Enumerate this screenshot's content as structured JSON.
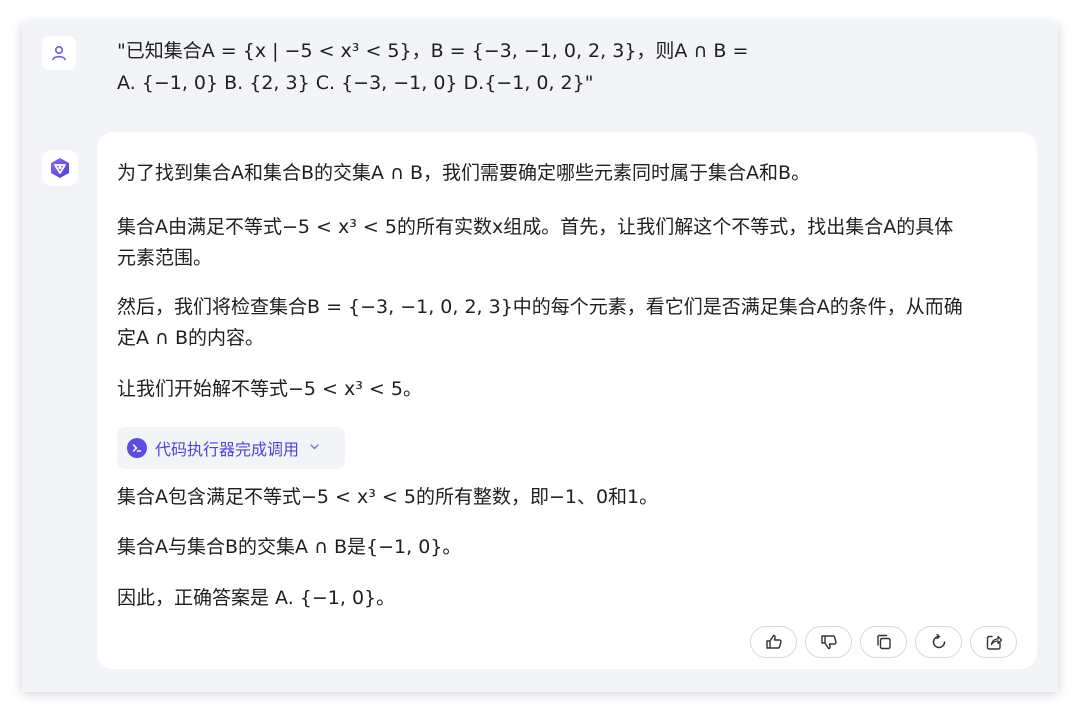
{
  "user_message": {
    "line1": "\"已知集合A = {x | −5 < x³ < 5}，B = {−3, −1, 0, 2, 3}，则A ∩ B =",
    "line2": "A. {−1, 0} B. {2, 3} C. {−3, −1, 0} D.{−1, 0, 2}\""
  },
  "answer": {
    "p1": "为了找到集合A和集合B的交集A ∩ B，我们需要确定哪些元素同时属于集合A和B。",
    "p2_line1": "集合A由满足不等式−5 < x³ < 5的所有实数x组成。首先，让我们解这个不等式，找出集合A的具体",
    "p2_line2": "元素范围。",
    "p3_line1": "然后，我们将检查集合B = {−3, −1, 0, 2, 3}中的每个元素，看它们是否满足集合A的条件，从而确",
    "p3_line2": "定A ∩ B的内容。",
    "p4": "让我们开始解不等式−5 < x³ < 5。",
    "tool_chip_label": "代码执行器完成调用",
    "p5": "集合A包含满足不等式−5 < x³ < 5的所有整数，即−1、0和1。",
    "p6": "集合A与集合B的交集A ∩ B是{−1, 0}。",
    "p7": "因此，正确答案是 A. {−1, 0}。"
  },
  "actions": {
    "like": "thumbs-up-icon",
    "dislike": "thumbs-down-icon",
    "copy": "copy-icon",
    "regenerate": "refresh-icon",
    "share": "share-icon"
  },
  "colors": {
    "window_bg": "#f3f4f8",
    "accent": "#5b4de0",
    "text": "#1f1f1f"
  }
}
